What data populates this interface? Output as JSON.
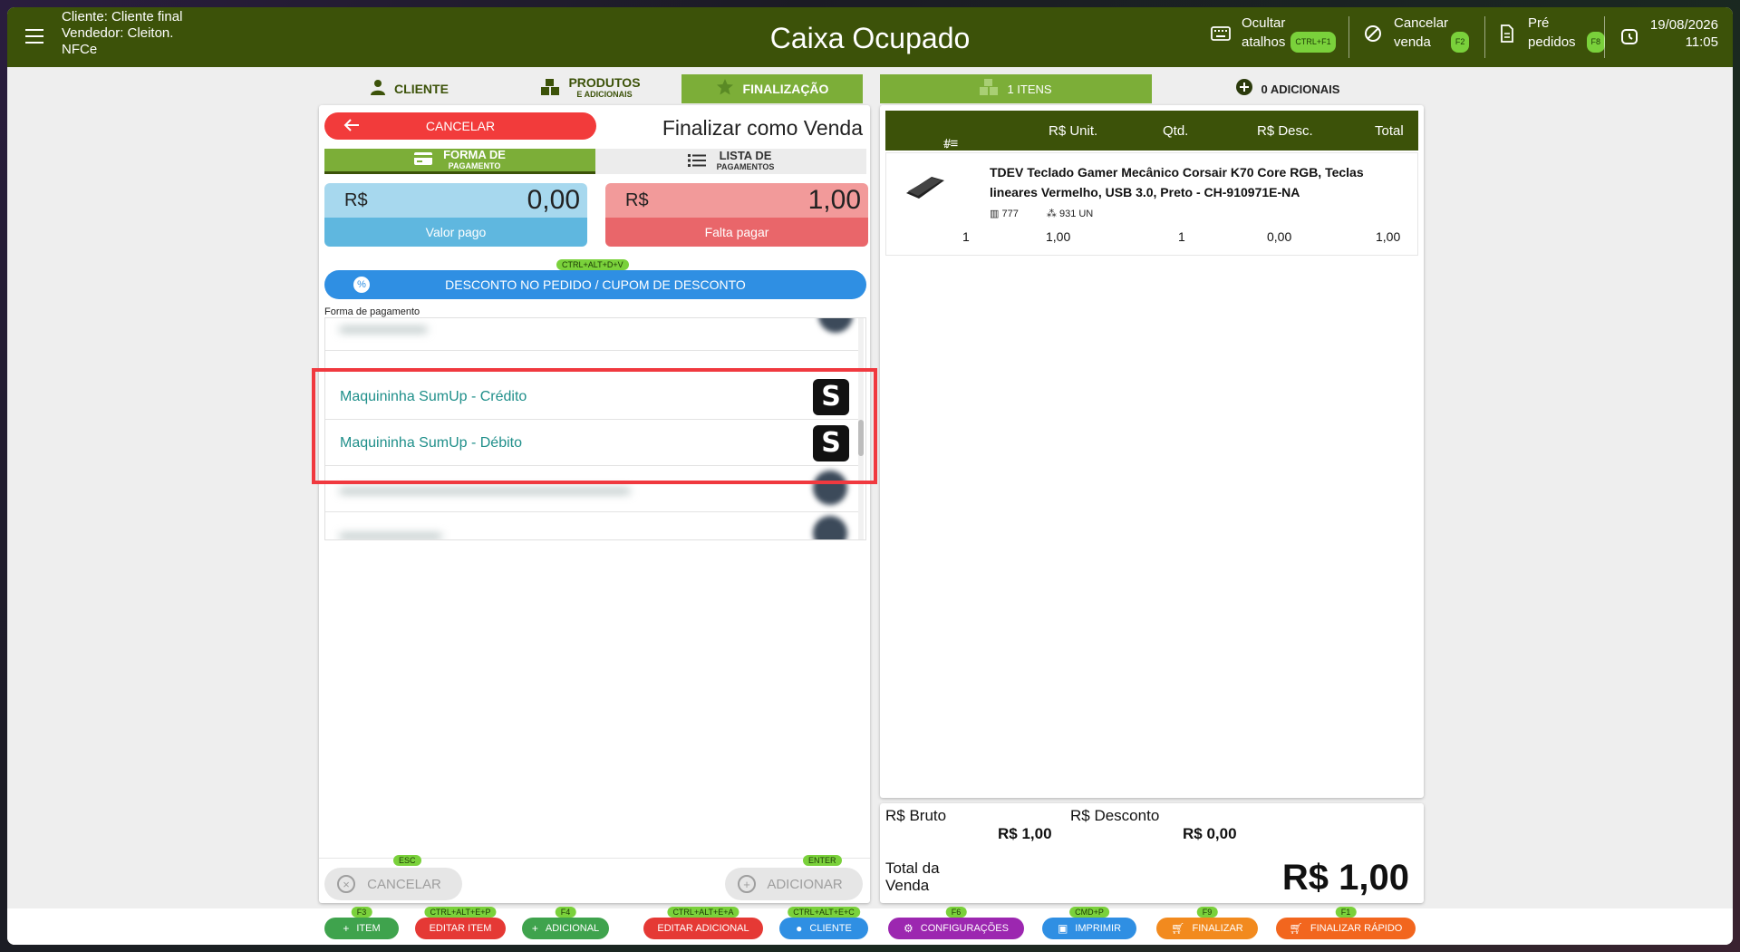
{
  "header": {
    "client": "Cliente: Cliente final",
    "seller": "Vendedor: Cleiton.",
    "doc_type": "NFCe",
    "title": "Caixa Ocupado",
    "hide_shortcuts_1": "Ocultar",
    "hide_shortcuts_2": "atalhos",
    "hide_shortcuts_kbd": "CTRL+F1",
    "cancel_sale_1": "Cancelar",
    "cancel_sale_2": "venda",
    "cancel_sale_kbd": "F2",
    "preorders_1": "Pré",
    "preorders_2": "pedidos",
    "preorders_kbd": "F8",
    "date": "19/08/2026",
    "time": "11:05"
  },
  "left_tabs": {
    "cliente": "CLIENTE",
    "produtos": "PRODUTOS",
    "produtos_sub": "E ADICIONAIS",
    "finalizacao": "FINALIZAÇÃO"
  },
  "right_tabs": {
    "itens": "1 ITENS",
    "adicionais": "0 ADICIONAIS"
  },
  "finalize": {
    "cancel_label": "CANCELAR",
    "title": "Finalizar como Venda",
    "subtab_forma": "FORMA DE",
    "subtab_forma_sub": "PAGAMENTO",
    "subtab_lista": "LISTA DE",
    "subtab_lista_sub": "PAGAMENTOS",
    "currency": "R$",
    "paid_value": "0,00",
    "paid_label": "Valor pago",
    "missing_value": "1,00",
    "missing_label": "Falta pagar",
    "discount_kbd": "CTRL+ALT+D+V",
    "discount_label": "DESCONTO NO PEDIDO / CUPOM DE DESCONTO",
    "payment_methods_label": "Forma de pagamento",
    "payment_methods": [
      {
        "label": "Maquininha SumUp - Crédito"
      },
      {
        "label": "Maquininha SumUp - Débito"
      }
    ],
    "bottom_cancel_kbd": "ESC",
    "bottom_cancel": "CANCELAR",
    "bottom_add_kbd": "ENTER",
    "bottom_add": "ADICIONAR"
  },
  "items_table": {
    "headers": [
      "#",
      "R$ Unit.",
      "Qtd.",
      "R$ Desc.",
      "Total"
    ],
    "rows": [
      {
        "name": "TDEV Teclado Gamer Mecânico Corsair K70 Core RGB, Teclas lineares Vermelho, USB 3.0, Preto - CH-910971E-NA",
        "code": "777",
        "stock": "931 UN",
        "index": "1",
        "unit": "1,00",
        "qty": "1",
        "disc": "0,00",
        "total": "1,00"
      }
    ]
  },
  "totals": {
    "gross_label": "R$ Bruto",
    "gross_value": "R$ 1,00",
    "discount_label": "R$ Desconto",
    "discount_value": "R$ 0,00",
    "total_label_1": "Total da",
    "total_label_2": "Venda",
    "total_value": "R$ 1,00"
  },
  "bottom_bar": [
    {
      "kbd": "F3",
      "label": "ITEM",
      "color": "#3fa34d"
    },
    {
      "kbd": "CTRL+ALT+E+P",
      "label": "EDITAR ITEM",
      "color": "#e53935"
    },
    {
      "kbd": "F4",
      "label": "ADICIONAL",
      "color": "#3fa34d"
    },
    {
      "kbd": "CTRL+ALT+E+A",
      "label": "EDITAR ADICIONAL",
      "color": "#e53935"
    },
    {
      "kbd": "CTRL+ALT+E+C",
      "label": "CLIENTE",
      "color": "#2f8fe3"
    },
    {
      "kbd": "F6",
      "label": "CONFIGURAÇÕES",
      "color": "#9c27b0"
    },
    {
      "kbd": "CMD+P",
      "label": "IMPRIMIR",
      "color": "#2f8fe3"
    },
    {
      "kbd": "F9",
      "label": "FINALIZAR",
      "color": "#f28a1e"
    },
    {
      "kbd": "F1",
      "label": "FINALIZAR RÁPIDO",
      "color": "#f2661e"
    }
  ],
  "colors": {
    "brand_dark": "#3c5209",
    "brand_light": "#7cae38",
    "accent_red": "#f23b3b"
  }
}
